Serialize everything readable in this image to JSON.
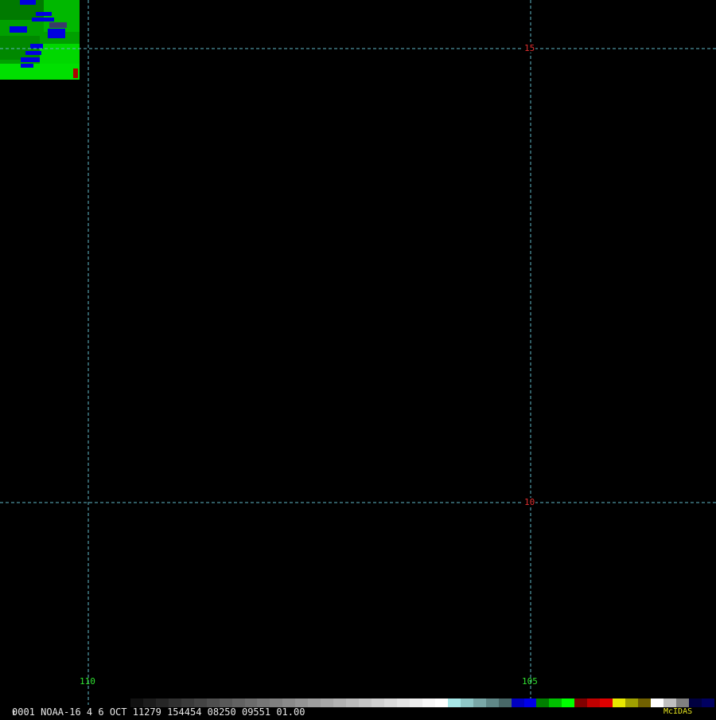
{
  "map": {
    "satellite_image_present": true,
    "grid_color": "#5fb8c8",
    "latitudes": [
      {
        "label": "15"
      },
      {
        "label": "10"
      }
    ],
    "longitudes": [
      {
        "label": "110"
      },
      {
        "label": "105"
      }
    ]
  },
  "footer": {
    "frame_index": "1",
    "status_text": "0001 NOAA-16     4  6 OCT 11279 154454 08250 09551 01.00",
    "brand": "McIDAS"
  },
  "colorbar": {
    "colors": [
      "#000000",
      "#111111",
      "#1c1c1c",
      "#262626",
      "#303030",
      "#3a3a3a",
      "#444444",
      "#4e4e4e",
      "#585858",
      "#626262",
      "#6c6c6c",
      "#767676",
      "#808080",
      "#8a8a8a",
      "#949494",
      "#9e9e9e",
      "#a8a8a8",
      "#b2b2b2",
      "#bcbcbc",
      "#c6c6c6",
      "#d0d0d0",
      "#dadada",
      "#e4e4e4",
      "#eeeeee",
      "#f8f8f8",
      "#ffffff",
      "#a8e8e8",
      "#90c8c8",
      "#7aa8a8",
      "#608888",
      "#486868",
      "#0000c0",
      "#0000e8",
      "#008000",
      "#00c000",
      "#00ff00",
      "#800000",
      "#c00000",
      "#e00000",
      "#e8e800",
      "#a0a000",
      "#706000",
      "#ffffff",
      "#c0c0c0",
      "#808080",
      "#000040",
      "#000060"
    ]
  }
}
